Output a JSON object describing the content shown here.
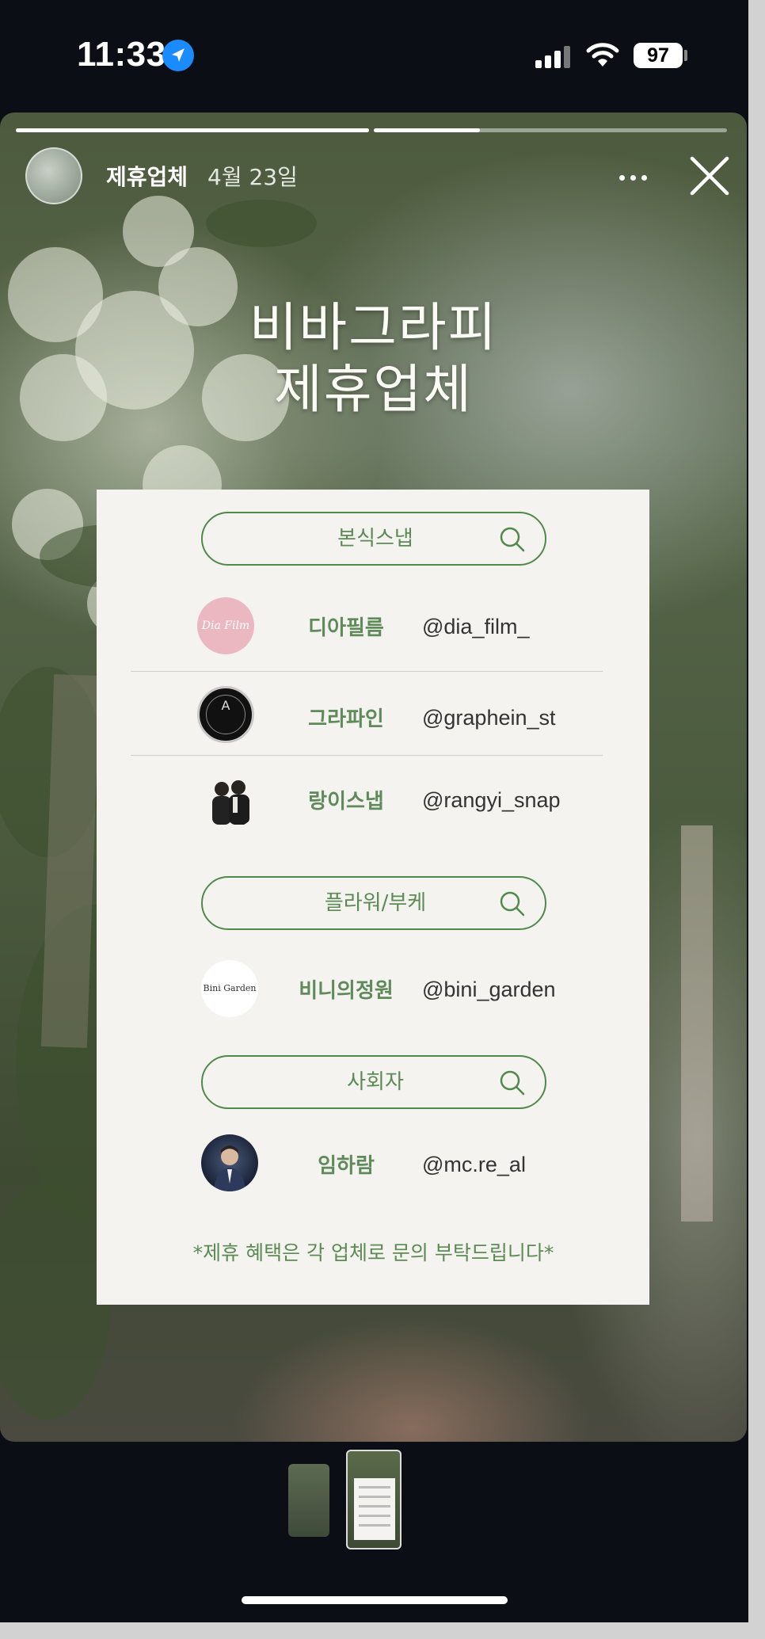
{
  "status_bar": {
    "time": "11:33",
    "battery": "97",
    "icons": [
      "location-arrow-icon",
      "signal-icon",
      "wifi-icon",
      "battery-icon"
    ]
  },
  "story": {
    "account_name": "제휴업체",
    "date": "4월 23일",
    "progress": [
      1.0,
      0.3,
      0.0
    ],
    "headline_line1": "비바그라피",
    "headline_line2": "제휴업체",
    "icons": [
      "more-icon",
      "close-icon"
    ]
  },
  "categories": [
    {
      "label": "본식스냅",
      "vendors": [
        {
          "name": "디아필름",
          "handle": "@dia_film_",
          "avatar_text": "Dia Film"
        },
        {
          "name": "그라파인",
          "handle": "@graphein_st",
          "avatar_text": "A"
        },
        {
          "name": "랑이스냅",
          "handle": "@rangyi_snap",
          "avatar_text": ""
        }
      ]
    },
    {
      "label": "플라워/부케",
      "vendors": [
        {
          "name": "비니의정원",
          "handle": "@bini_garden",
          "avatar_text": "Bini Garden"
        }
      ]
    },
    {
      "label": "사회자",
      "vendors": [
        {
          "name": "임하람",
          "handle": "@mc.re_al",
          "avatar_text": ""
        }
      ]
    }
  ],
  "footnote": "*제휴 혜택은 각 업체로 문의 부탁드립니다*",
  "colors": {
    "accent_green": "#5b8a55",
    "panel_bg": "#f4f3ef",
    "app_bg": "#0b0e14"
  }
}
